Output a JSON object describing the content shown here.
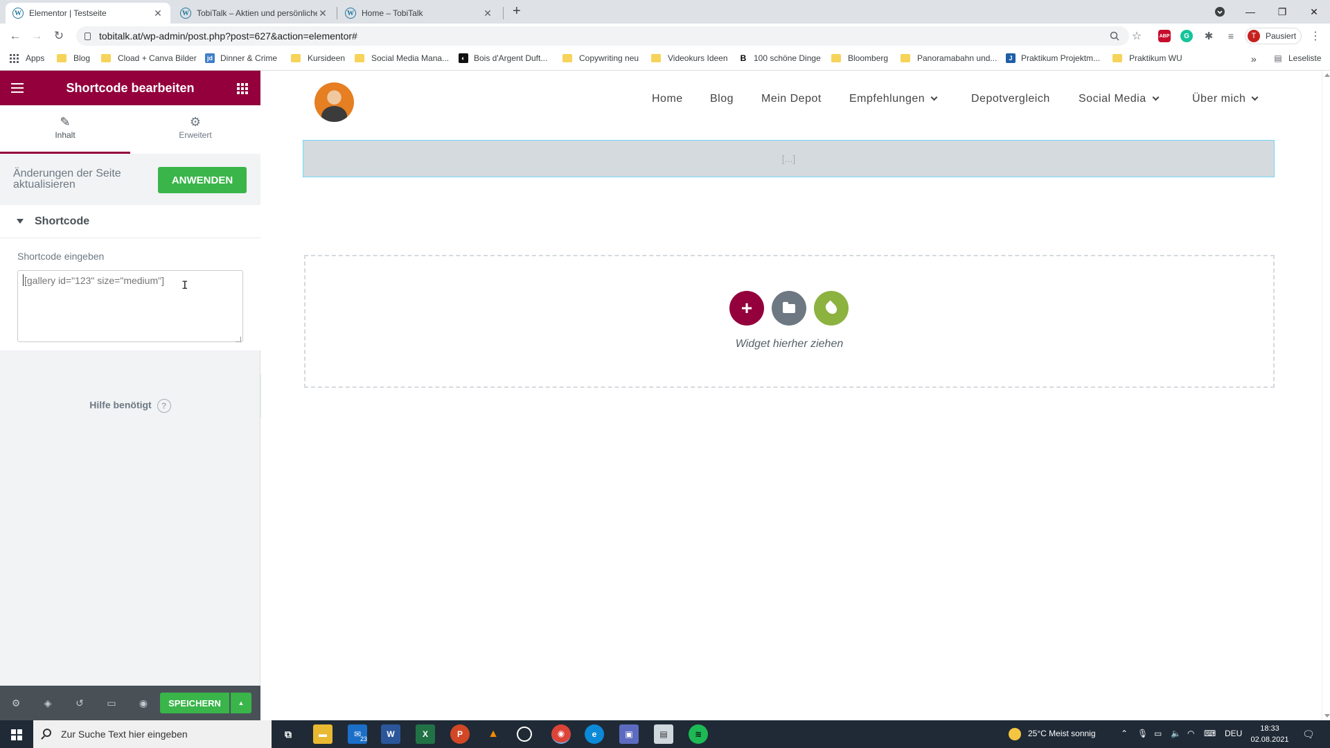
{
  "browser": {
    "tabs": [
      {
        "title": "Elementor | Testseite",
        "active": true
      },
      {
        "title": "TobiTalk – Aktien und persönliche",
        "active": false
      },
      {
        "title": "Home – TobiTalk",
        "active": false
      }
    ],
    "new_tab": "+",
    "url": "tobitalk.at/wp-admin/post.php?post=627&action=elementor#",
    "profile_initial": "T",
    "profile_status": "Pausiert",
    "bookmarks": [
      {
        "label": "Apps",
        "icon": "apps-grid-icon"
      },
      {
        "label": "Blog",
        "icon": "folder-icon"
      },
      {
        "label": "Cload + Canva Bilder",
        "icon": "folder-icon"
      },
      {
        "label": "Dinner & Crime",
        "icon": "jd-site-icon"
      },
      {
        "label": "Kursideen",
        "icon": "folder-icon"
      },
      {
        "label": "Social Media Mana...",
        "icon": "folder-icon"
      },
      {
        "label": "Bois d'Argent Duft...",
        "icon": "ba-site-icon"
      },
      {
        "label": "Copywriting neu",
        "icon": "folder-icon"
      },
      {
        "label": "Videokurs Ideen",
        "icon": "folder-icon"
      },
      {
        "label": "100 schöne Dinge",
        "icon": "b-site-icon"
      },
      {
        "label": "Bloomberg",
        "icon": "folder-icon"
      },
      {
        "label": "Panoramabahn und...",
        "icon": "folder-icon"
      },
      {
        "label": "Praktikum Projektm...",
        "icon": "j-site-icon"
      },
      {
        "label": "Praktikum WU",
        "icon": "folder-icon"
      }
    ],
    "bookmarks_more": "»",
    "reading_list": "Leseliste"
  },
  "panel": {
    "title": "Shortcode bearbeiten",
    "tabs": [
      {
        "label": "Inhalt",
        "icon": "pencil-icon"
      },
      {
        "label": "Erweitert",
        "icon": "gear-icon"
      }
    ],
    "apply_text": "Änderungen der Seite aktualisieren",
    "apply_button": "ANWENDEN",
    "section_title": "Shortcode",
    "field_label": "Shortcode eingeben",
    "field_placeholder": "[gallery id=\"123\" size=\"medium\"]",
    "help_text": "Hilfe benötigt",
    "save_button": "SPEICHERN",
    "accent_color": "#93003c",
    "success_color": "#39b54a"
  },
  "site": {
    "nav": [
      {
        "label": "Home",
        "dropdown": false
      },
      {
        "label": "Blog",
        "dropdown": false
      },
      {
        "label": "Mein Depot",
        "dropdown": false
      },
      {
        "label": "Empfehlungen",
        "dropdown": true
      },
      {
        "label": "Depotvergleich",
        "dropdown": false
      },
      {
        "label": "Social Media",
        "dropdown": true
      },
      {
        "label": "Über mich",
        "dropdown": true
      }
    ],
    "shortcode_preview": "[...]",
    "drop_text": "Widget hierher ziehen"
  },
  "taskbar": {
    "search_placeholder": "Zur Suche Text hier eingeben",
    "mail_badge": "23",
    "weather": "25°C  Meist sonnig",
    "language": "DEU",
    "time": "18:33",
    "date": "02.08.2021"
  }
}
